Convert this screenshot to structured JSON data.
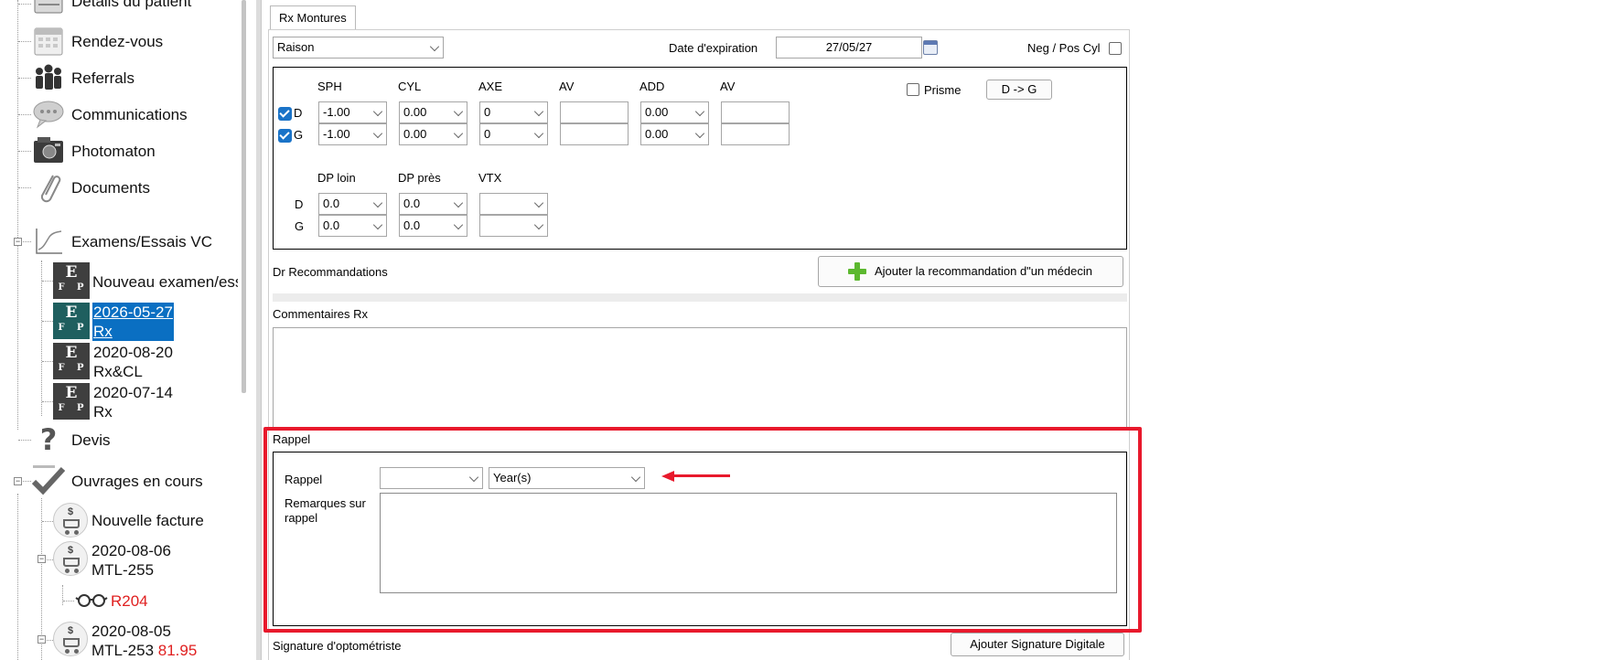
{
  "tree": {
    "items": [
      {
        "label": "Détails du patient",
        "icon": "patient-details-icon"
      },
      {
        "label": "Rendez-vous",
        "icon": "calendar-icon"
      },
      {
        "label": "Referrals",
        "icon": "people-icon"
      },
      {
        "label": "Communications",
        "icon": "speech-bubble-icon"
      },
      {
        "label": "Photomaton",
        "icon": "photo-folder-icon"
      },
      {
        "label": "Documents",
        "icon": "paperclip-icon"
      },
      {
        "label": "Examens/Essais VC",
        "icon": "chart-line-icon"
      },
      {
        "label": "Devis",
        "icon": "question-mark-icon"
      },
      {
        "label": "Ouvrages en cours",
        "icon": "checkmark-icon"
      }
    ],
    "exams": [
      {
        "line1": "Nouveau examen/essai",
        "line2": ""
      },
      {
        "line1": "2026-05-27",
        "line2": "Rx"
      },
      {
        "line1": "2020-08-20",
        "line2": "Rx&CL"
      },
      {
        "line1": "2020-07-14",
        "line2": "Rx"
      }
    ],
    "efp_letters": {
      "top": "E",
      "bottom": "F P"
    },
    "orders": {
      "new_invoice": "Nouvelle facture",
      "order1": {
        "date": "2020-08-06",
        "ref": "MTL-255"
      },
      "frame_ref": "R204",
      "order2": {
        "date": "2020-08-05",
        "ref": "MTL-253",
        "amount": "81.95"
      },
      "currency_symbol": "$"
    }
  },
  "tab": {
    "label": "Rx Montures"
  },
  "header": {
    "reason_value": "Raison",
    "expiration_label": "Date d'expiration",
    "expiration_value": "27/05/27",
    "negpos_label": "Neg / Pos Cyl"
  },
  "rx": {
    "columns": [
      "SPH",
      "CYL",
      "AXE",
      "AV",
      "ADD",
      "AV"
    ],
    "rows": [
      {
        "eye": "D",
        "sph": "-1.00",
        "cyl": "0.00",
        "axe": "0",
        "av": "",
        "add": "0.00",
        "av2": ""
      },
      {
        "eye": "G",
        "sph": "-1.00",
        "cyl": "0.00",
        "axe": "0",
        "av": "",
        "add": "0.00",
        "av2": ""
      }
    ],
    "prism_label": "Prisme",
    "copy_button": "D -> G",
    "pd_columns": [
      "DP loin",
      "DP près",
      "VTX"
    ],
    "pd_rows": [
      {
        "eye": "D",
        "far": "0.0",
        "near": "0.0",
        "vtx": ""
      },
      {
        "eye": "G",
        "far": "0.0",
        "near": "0.0",
        "vtx": ""
      }
    ]
  },
  "recommendations": {
    "label": "Dr Recommandations",
    "add_button": "Ajouter la recommandation d\"un médecin"
  },
  "comments": {
    "label": "Commentaires Rx",
    "value": ""
  },
  "recall": {
    "section_label": "Rappel",
    "field_label": "Rappel",
    "amount_value": "",
    "unit_value": "Year(s)",
    "remarks_label_1": "Remarques sur",
    "remarks_label_2": "rappel",
    "remarks_value": ""
  },
  "signature": {
    "label": "Signature d'optométriste",
    "add_button": "Ajouter Signature Digitale"
  },
  "colors": {
    "highlight": "#e8192c",
    "selection": "#0a6fc2",
    "amount_red": "#e02020"
  }
}
